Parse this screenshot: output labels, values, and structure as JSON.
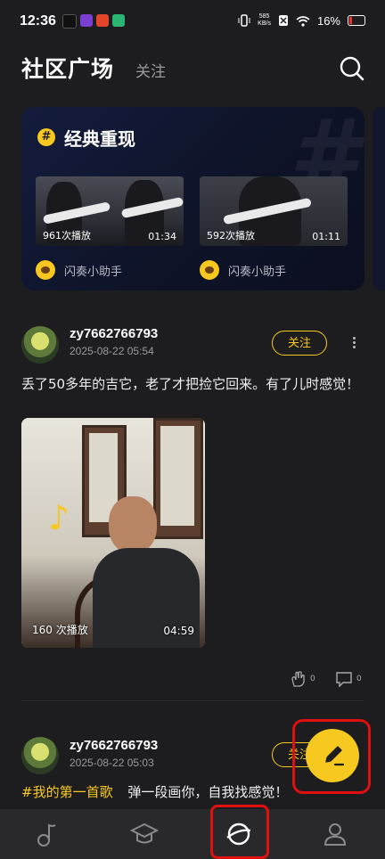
{
  "status_bar": {
    "time": "12:36",
    "net_speed": "585\nKB/s",
    "battery": "16%"
  },
  "header": {
    "title": "社区广场",
    "follow_tab": "关注"
  },
  "classics_card": {
    "title": "经典重现",
    "badge": "#",
    "videos": [
      {
        "plays": "961次播放",
        "duration": "01:34",
        "author": "闪奏小助手"
      },
      {
        "plays": "592次播放",
        "duration": "01:11",
        "author": "闪奏小助手"
      }
    ]
  },
  "posts": [
    {
      "username": "zy7662766793",
      "date": "2025-08-22 05:54",
      "follow_label": "关注",
      "text": "丢了50多年的吉它，老了才把捡它回来。有了儿时感觉！",
      "media": {
        "plays": "160 次播放",
        "duration": "04:59"
      },
      "likes": "0",
      "comments": "0"
    },
    {
      "username": "zy7662766793",
      "date": "2025-08-22 05:03",
      "follow_label": "关注",
      "hashtag": "#我的第一首歌",
      "text": "弹一段画你，自我找感觉！"
    }
  ],
  "icons": {
    "search": "search-icon",
    "more": "more-icon",
    "like": "clap-icon",
    "comment": "comment-icon",
    "fab": "pencil-icon",
    "tabs": [
      "music-note-icon",
      "graduation-cap-icon",
      "planet-icon",
      "profile-icon"
    ]
  },
  "colors": {
    "accent": "#f7c81f",
    "highlight": "#e01010",
    "bg": "#1d1d1f"
  }
}
